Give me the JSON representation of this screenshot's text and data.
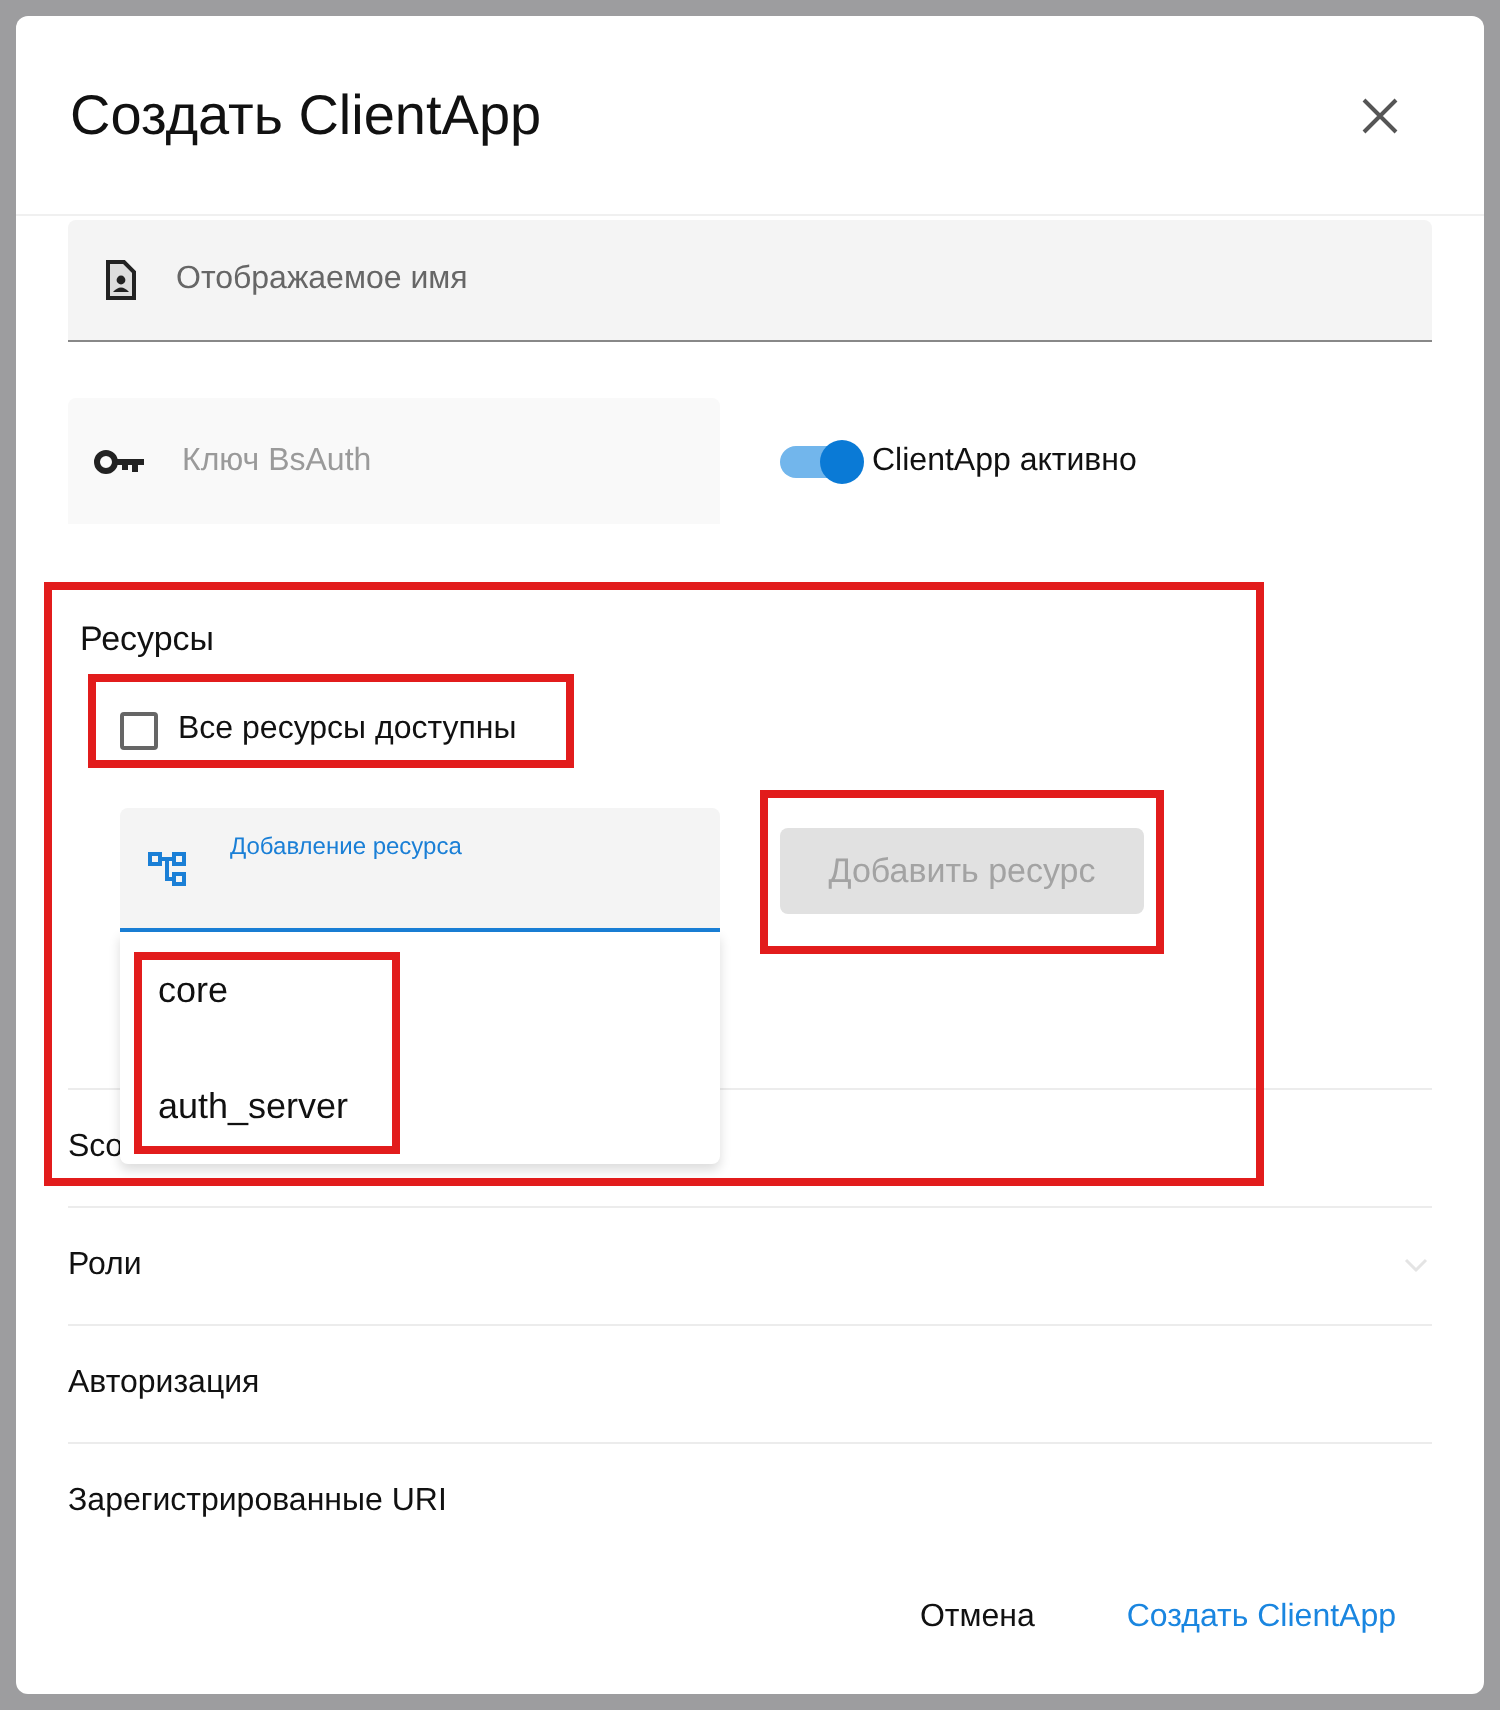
{
  "dialog": {
    "title": "Создать ClientApp"
  },
  "display_name_field": {
    "placeholder": "Отображаемое имя"
  },
  "bsauth_key_field": {
    "placeholder": "Ключ BsAuth",
    "disabled": true
  },
  "active_switch": {
    "label": "ClientApp активно",
    "on": true
  },
  "resources": {
    "title": "Ресурсы",
    "all_available": {
      "label": "Все ресурсы доступны",
      "checked": false
    },
    "add_field": {
      "label": "Добавление ресурса",
      "focused": true
    },
    "add_button": {
      "label": "Добавить ресурс",
      "disabled": true
    },
    "options": [
      "core",
      "auth_server"
    ]
  },
  "sections": [
    {
      "title": "Sco",
      "chevron": false
    },
    {
      "title": "Роли",
      "chevron": true
    },
    {
      "title": "Авторизация",
      "chevron": false
    },
    {
      "title": "Зарегистрированные URI",
      "chevron": false
    }
  ],
  "actions": {
    "cancel": "Отмена",
    "create": "Создать ClientApp"
  }
}
